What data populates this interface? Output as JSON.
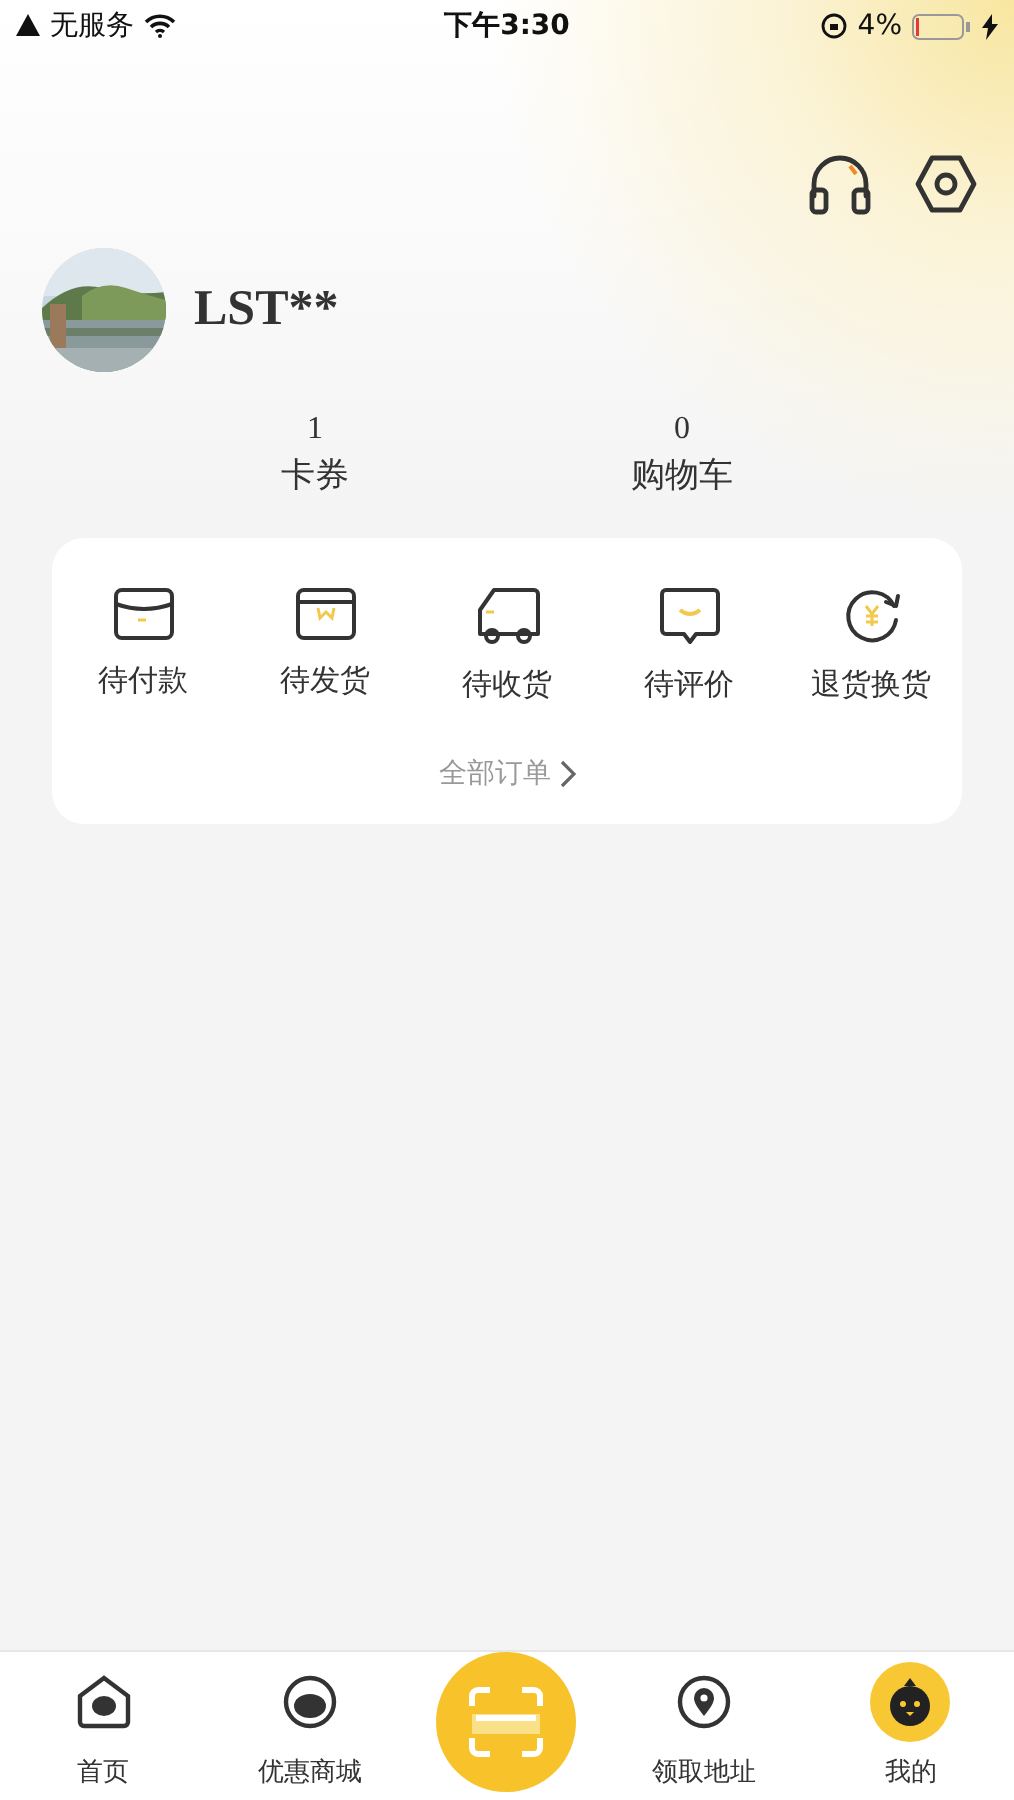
{
  "status_bar": {
    "carrier": "无服务",
    "time": "下午3:30",
    "battery": "4%"
  },
  "user": {
    "name": "LST**"
  },
  "stats": [
    {
      "value": "1",
      "label": "卡券"
    },
    {
      "value": "0",
      "label": "购物车"
    }
  ],
  "orders": {
    "items": [
      {
        "kind": "pay",
        "label": "待付款"
      },
      {
        "kind": "ship",
        "label": "待发货"
      },
      {
        "kind": "receive",
        "label": "待收货"
      },
      {
        "kind": "review",
        "label": "待评价"
      },
      {
        "kind": "refund",
        "label": "退货换货"
      }
    ],
    "all_link": "全部订单"
  },
  "tab_bar": [
    {
      "kind": "home",
      "label": "首页",
      "selected": false
    },
    {
      "kind": "mall",
      "label": "优惠商城",
      "selected": false
    },
    {
      "kind": "scan",
      "selected": false
    },
    {
      "kind": "location",
      "label": "领取地址",
      "selected": false
    },
    {
      "kind": "mine",
      "label": "我的",
      "selected": true
    }
  ]
}
